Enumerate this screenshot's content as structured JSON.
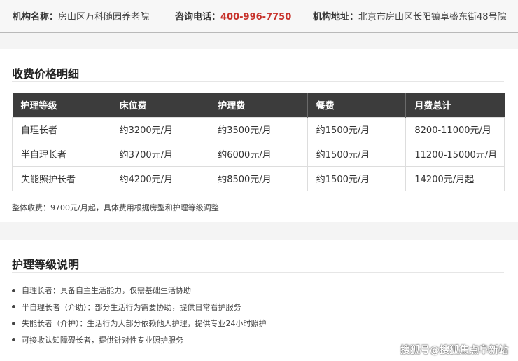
{
  "header": {
    "name_label": "机构名称：",
    "name_value": "房山区万科随园养老院",
    "phone_label": "咨询电话：",
    "phone_value": "400-996-7750",
    "address_label": "机构地址：",
    "address_value": "北京市房山区长阳镇阜盛东街48号院",
    "phone_color": "#c7322b"
  },
  "pricing": {
    "title": "收费价格明细",
    "columns": [
      "护理等级",
      "床位费",
      "护理费",
      "餐费",
      "月费总计"
    ],
    "rows": [
      [
        "自理长者",
        "约3200元/月",
        "约3500元/月",
        "约1500元/月",
        "8200-11000元/月"
      ],
      [
        "半自理长者",
        "约3700元/月",
        "约6000元/月",
        "约1500元/月",
        "11200-15000元/月"
      ],
      [
        "失能照护长者",
        "约4200元/月",
        "约8500元/月",
        "约1500元/月",
        "14200元/月起"
      ]
    ],
    "note": "整体收费：9700元/月起，具体费用根据房型和护理等级调整"
  },
  "care_levels": {
    "title": "护理等级说明",
    "items": [
      "自理长者：具备自主生活能力，仅需基础生活协助",
      "半自理长者（介助）：部分生活行为需要协助，提供日常看护服务",
      "失能长者（介护）：生活行为大部分依赖他人护理，提供专业24小时照护",
      "可接收认知障碍长者，提供针对性专业照护服务"
    ]
  },
  "watermark": "搜狐号@搜狐焦点阜新站"
}
